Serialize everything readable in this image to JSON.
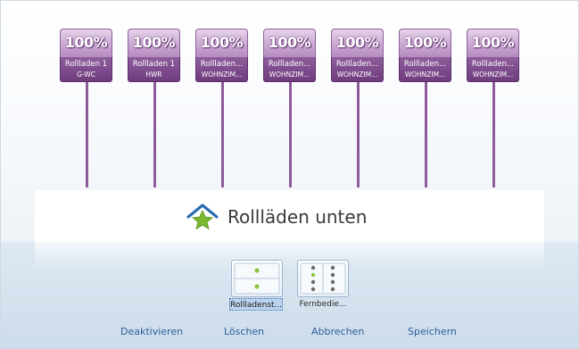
{
  "devices": [
    {
      "percent": "100%",
      "name": "Rollladen 1",
      "room": "G-WC"
    },
    {
      "percent": "100%",
      "name": "Rollladen 1",
      "room": "HWR"
    },
    {
      "percent": "100%",
      "name": "Rollladen...",
      "room": "WOHNZIM..."
    },
    {
      "percent": "100%",
      "name": "Rollladen...",
      "room": "WOHNZIM..."
    },
    {
      "percent": "100%",
      "name": "Rollladen...",
      "room": "WOHNZIM..."
    },
    {
      "percent": "100%",
      "name": "Rollladen...",
      "room": "WOHNZIM..."
    },
    {
      "percent": "100%",
      "name": "Rollladen...",
      "room": "WOHNZIM..."
    }
  ],
  "scene": {
    "title": "Rollläden unten",
    "icon": "house-star-icon"
  },
  "tools": [
    {
      "label": "Rollladenst...",
      "icon": "roller-shutter-switch-icon",
      "selected": true
    },
    {
      "label": "Fernbedie...",
      "icon": "remote-control-icon",
      "selected": false
    }
  ],
  "actions": {
    "deactivate": "Deaktivieren",
    "delete": "Löschen",
    "cancel": "Abbrechen",
    "save": "Speichern"
  },
  "colors": {
    "tile_purple": "#6f3c7e",
    "tile_light": "#cfb0d6",
    "house_blue": "#2a6db0",
    "star_green": "#7cb82f",
    "link_blue": "#2d5f99"
  }
}
